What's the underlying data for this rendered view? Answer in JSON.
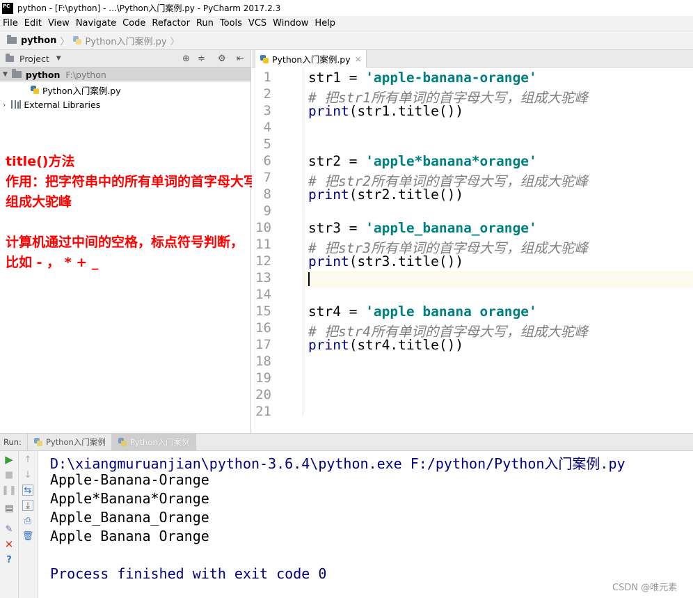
{
  "window": {
    "title": "python - [F:\\python] - ...\\Python入门案例.py - PyCharm 2017.2.3",
    "logo_text": "PC"
  },
  "menu": [
    "File",
    "Edit",
    "View",
    "Navigate",
    "Code",
    "Refactor",
    "Run",
    "Tools",
    "VCS",
    "Window",
    "Help"
  ],
  "breadcrumb": {
    "project": "python",
    "file": "Python入门案例.py"
  },
  "project_panel": {
    "header": "Project",
    "root_name": "python",
    "root_path": "F:\\python",
    "file": "Python入门案例.py",
    "external": "External Libraries"
  },
  "annotation": {
    "line1": "title()方法",
    "line2": "作用：把字符串中的所有单词的首字母大写，",
    "line3": "组成大驼峰",
    "line4": "计算机通过中间的空格，标点符号判断，",
    "line5": "比如 -  ，  *  +  _"
  },
  "editor": {
    "tab_label": "Python入门案例.py",
    "line_numbers": [
      "1",
      "2",
      "3",
      "4",
      "5",
      "6",
      "7",
      "8",
      "9",
      "10",
      "11",
      "12",
      "13",
      "14",
      "15",
      "16",
      "17",
      "18",
      "19",
      "20",
      "21"
    ],
    "code": {
      "l1_var": "str1 = ",
      "l1_str": "'apple-banana-orange'",
      "l2_cmt": "# 把str1所有单词的首字母大写，组成大驼峰",
      "l3_a": "print",
      "l3_b": "(str1.title())",
      "l6_var": "str2 = ",
      "l6_str": "'apple*banana*orange'",
      "l7_cmt": "# 把str2所有单词的首字母大写，组成大驼峰",
      "l8_a": "print",
      "l8_b": "(str2.title())",
      "l10_var": "str3 = ",
      "l10_str": "'apple_banana_orange'",
      "l11_cmt": "# 把str3所有单词的首字母大写，组成大驼峰",
      "l12_a": "print",
      "l12_b": "(str3.title())",
      "l15_var": "str4 = ",
      "l15_str": "'apple banana orange'",
      "l16_cmt": "# 把str4所有单词的首字母大写，组成大驼峰",
      "l17_a": "print",
      "l17_b": "(str4.title())"
    }
  },
  "run": {
    "label": "Run:",
    "tabs": [
      "Python入门案例",
      "Python入门案例"
    ],
    "console": [
      "D:\\xiangmuruanjian\\python-3.6.4\\python.exe F:/python/Python入门案例.py",
      "Apple-Banana-Orange",
      "Apple*Banana*Orange",
      "Apple_Banana_Orange",
      "Apple Banana Orange",
      "Process finished with exit code 0"
    ]
  },
  "watermark": "CSDN @唯元素",
  "colors": {
    "string": "#008080",
    "comment": "#808080",
    "console_blue": "#000080",
    "annotation": "#ff0000"
  }
}
